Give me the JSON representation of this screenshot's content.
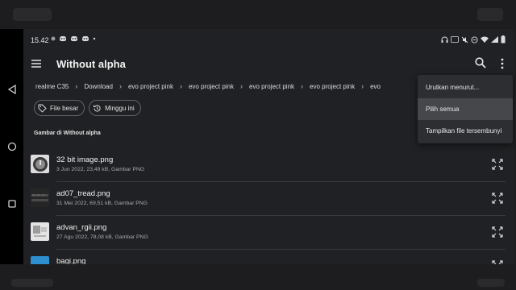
{
  "status": {
    "time": "15.42"
  },
  "appbar": {
    "title": "Without alpha"
  },
  "breadcrumb": [
    "realme C35",
    "Download",
    "evo project pink",
    "evo project pink",
    "evo project pink",
    "evo project pink",
    "evo"
  ],
  "chips": [
    {
      "label": "File besar",
      "icon": "tag-icon"
    },
    {
      "label": "Minggu ini",
      "icon": "history-icon"
    }
  ],
  "section": {
    "label": "Gambar di Without alpha"
  },
  "files": [
    {
      "name": "32 bit image.png",
      "meta": "3 Jun 2022, 23,49 kB, Gambar PNG"
    },
    {
      "name": "ad07_tread.png",
      "meta": "31 Mei 2022, 69,51 kB, Gambar PNG"
    },
    {
      "name": "advan_rgii.png",
      "meta": "27 Agu 2022, 78,08 kB, Gambar PNG"
    },
    {
      "name": "bagi.png",
      "meta": ""
    }
  ],
  "menu": {
    "items": [
      "Urutkan menurut...",
      "Pilih semua",
      "Tampilkan file tersembunyi"
    ],
    "selected_index": 1
  },
  "colors": {
    "background": "#202124",
    "menu_bg": "#2d2e31",
    "menu_selected": "#45474a"
  }
}
